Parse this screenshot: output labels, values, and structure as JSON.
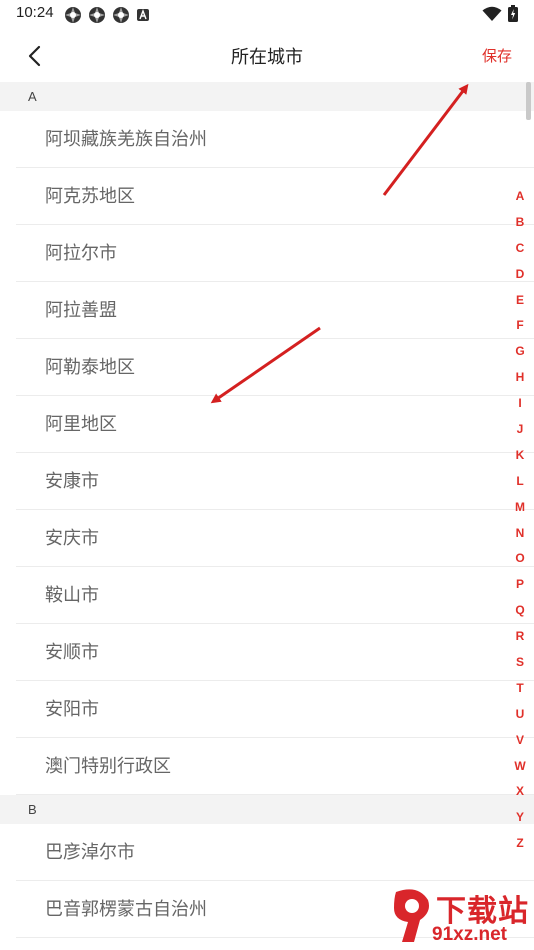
{
  "status_bar": {
    "time": "10:24",
    "notification_icons": [
      "app-icon",
      "app-icon",
      "app-icon",
      "a-icon"
    ],
    "right_icons": [
      "wifi-icon",
      "battery-icon"
    ]
  },
  "nav": {
    "title": "所在城市",
    "save_label": "保存"
  },
  "sections": [
    {
      "letter": "A",
      "cities": [
        "阿坝藏族羌族自治州",
        "阿克苏地区",
        "阿拉尔市",
        "阿拉善盟",
        "阿勒泰地区",
        "阿里地区",
        "安康市",
        "安庆市",
        "鞍山市",
        "安顺市",
        "安阳市",
        "澳门特别行政区"
      ]
    },
    {
      "letter": "B",
      "cities": [
        "巴彦淖尔市",
        "巴音郭楞蒙古自治州"
      ]
    }
  ],
  "index_letters": [
    "A",
    "B",
    "C",
    "D",
    "E",
    "F",
    "G",
    "H",
    "I",
    "J",
    "K",
    "L",
    "M",
    "N",
    "O",
    "P",
    "Q",
    "R",
    "S",
    "T",
    "U",
    "V",
    "W",
    "X",
    "Y",
    "Z"
  ],
  "colors": {
    "accent": "#e0302a",
    "section_bg": "#f3f3f3",
    "city_text": "#666666"
  },
  "watermark": {
    "brand": "下载站",
    "site": "91xz.net"
  }
}
